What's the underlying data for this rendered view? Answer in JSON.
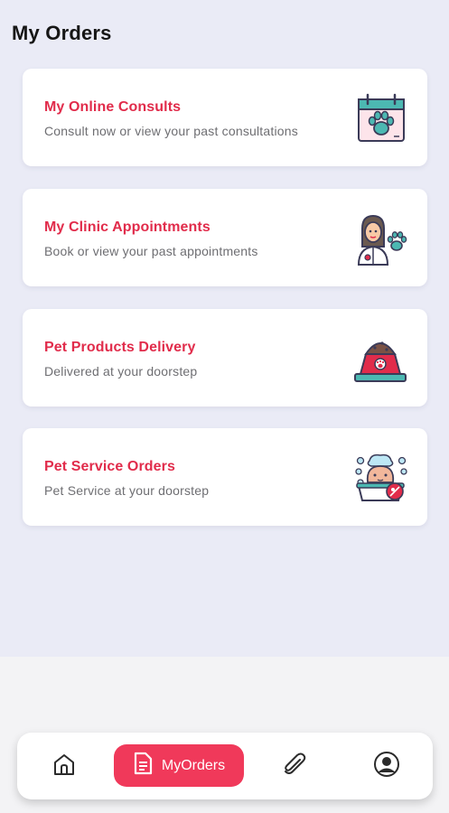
{
  "page": {
    "title": "My Orders"
  },
  "cards": [
    {
      "title": "My Online Consults",
      "subtitle": "Consult now or view your past consultations",
      "icon": "calendar-paw-icon"
    },
    {
      "title": "My Clinic Appointments",
      "subtitle": "Book or view your past appointments",
      "icon": "veterinarian-icon"
    },
    {
      "title": "Pet Products Delivery",
      "subtitle": "Delivered at your doorstep",
      "icon": "pet-food-bowl-icon"
    },
    {
      "title": "Pet Service Orders",
      "subtitle": "Pet Service at your doorstep",
      "icon": "pet-grooming-icon"
    }
  ],
  "bottom_nav": {
    "items": [
      {
        "name": "home",
        "icon": "home-icon"
      },
      {
        "name": "myorders",
        "icon": "document-icon",
        "label": "MyOrders",
        "active": true
      },
      {
        "name": "attachments",
        "icon": "paperclip-icon"
      },
      {
        "name": "profile",
        "icon": "user-circle-icon"
      }
    ]
  },
  "colors": {
    "accent": "#e12c4b",
    "nav_active_bg": "#f0395a",
    "content_bg": "#eaebf6",
    "teal": "#4cb8b2",
    "outline": "#3b3b58"
  }
}
